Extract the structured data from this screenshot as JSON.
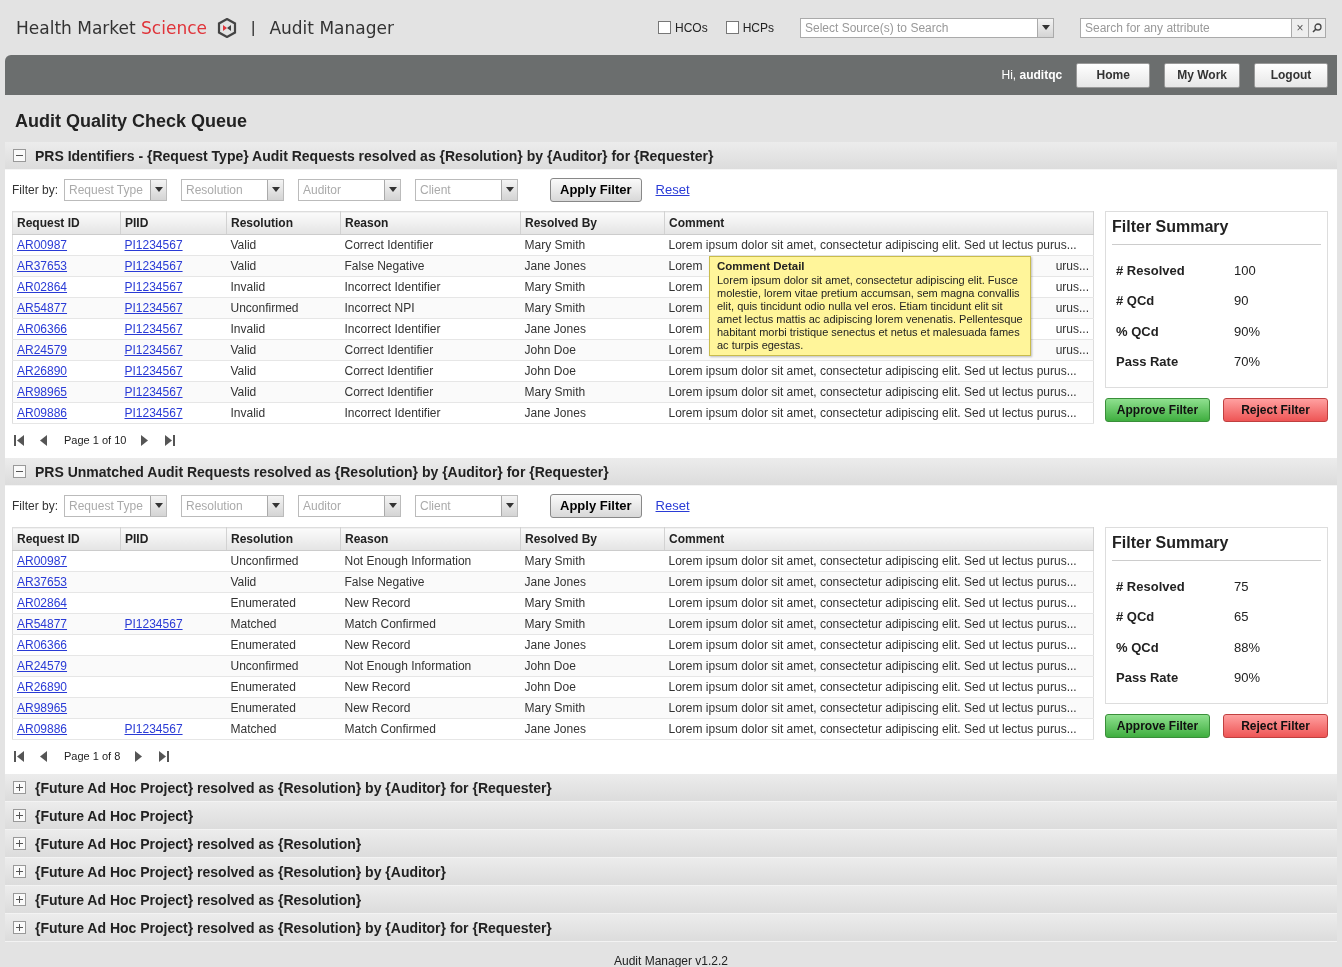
{
  "header": {
    "brand_part1": "Health Market ",
    "brand_part2": "Science",
    "separator": "|",
    "app_name": "Audit Manager",
    "checkboxes": [
      {
        "label": "HCOs",
        "checked": false
      },
      {
        "label": "HCPs",
        "checked": false
      }
    ],
    "source_select": {
      "placeholder": "Select Source(s) to Search"
    },
    "search": {
      "placeholder": "Search for any attribute",
      "clear": "×"
    }
  },
  "nav": {
    "greeting": "Hi, ",
    "user": "auditqc",
    "buttons": [
      "Home",
      "My Work",
      "Logout"
    ]
  },
  "page_title": "Audit Quality Check Queue",
  "sections": [
    {
      "title": "PRS Identifiers - {Request Type} Audit Requests resolved as {Resolution} by {Auditor} for {Requester}",
      "expanded": true,
      "filter_label": "Filter by:",
      "filters": [
        "Request Type",
        "Resolution",
        "Auditor",
        "Client"
      ],
      "apply": "Apply Filter",
      "reset": "Reset",
      "columns": [
        "Request ID",
        "PIID",
        "Resolution",
        "Reason",
        "Resolved By",
        "Comment"
      ],
      "rows": [
        {
          "id": "AR00987",
          "piid": "PI1234567",
          "resolution": "Valid",
          "reason": "Correct Identifier",
          "by": "Mary Smith",
          "comment": "Lorem ipsum dolor sit amet, consectetur adipiscing elit. Sed ut lectus purus..."
        },
        {
          "id": "AR37653",
          "piid": "PI1234567",
          "resolution": "Valid",
          "reason": "False Negative",
          "by": "Jane Jones",
          "comment": "Lorem",
          "comment_end": "urus..."
        },
        {
          "id": "AR02864",
          "piid": "PI1234567",
          "resolution": "Invalid",
          "reason": "Incorrect Identifier",
          "by": "Mary Smith",
          "comment": "Lorem",
          "comment_end": "urus..."
        },
        {
          "id": "AR54877",
          "piid": "PI1234567",
          "resolution": "Unconfirmed",
          "reason": "Incorrect NPI",
          "by": "Mary Smith",
          "comment": "Lorem",
          "comment_end": "urus..."
        },
        {
          "id": "AR06366",
          "piid": "PI1234567",
          "resolution": "Invalid",
          "reason": "Incorrect Identifier",
          "by": "Jane Jones",
          "comment": "Lorem",
          "comment_end": "urus..."
        },
        {
          "id": "AR24579",
          "piid": "PI1234567",
          "resolution": "Valid",
          "reason": "Correct Identifier",
          "by": "John Doe",
          "comment": "Lorem",
          "comment_end": "urus..."
        },
        {
          "id": "AR26890",
          "piid": "PI1234567",
          "resolution": "Valid",
          "reason": "Correct Identifier",
          "by": "John Doe",
          "comment": "Lorem ipsum dolor sit amet, consectetur adipiscing elit. Sed ut lectus purus..."
        },
        {
          "id": "AR98965",
          "piid": "PI1234567",
          "resolution": "Valid",
          "reason": "Correct Identifier",
          "by": "Mary Smith",
          "comment": "Lorem ipsum dolor sit amet, consectetur adipiscing elit. Sed ut lectus purus..."
        },
        {
          "id": "AR09886",
          "piid": "PI1234567",
          "resolution": "Invalid",
          "reason": "Incorrect Identifier",
          "by": "Jane Jones",
          "comment": "Lorem ipsum dolor sit amet, consectetur adipiscing elit. Sed ut lectus purus..."
        }
      ],
      "tooltip": {
        "title": "Comment Detail",
        "text": "Lorem ipsum dolor sit amet, consectetur adipiscing elit. Fusce molestie, lorem vitae pretium accumsan, sem magna convallis elit, quis tincidunt odio nulla vel eros. Etiam tincidunt elit sit amet lectus mattis ac adipiscing lorem venenatis. Pellentesque habitant morbi tristique senectus et netus et malesuada fames ac turpis egestas."
      },
      "pager": "Page 1 of 10",
      "summary": {
        "title": "Filter Summary",
        "stats": [
          {
            "label": "# Resolved",
            "value": "100"
          },
          {
            "label": "# QCd",
            "value": "90"
          },
          {
            "label": "% QCd",
            "value": "90%"
          },
          {
            "label": "Pass Rate",
            "value": "70%"
          }
        ],
        "approve": "Approve Filter",
        "reject": "Reject Filter"
      }
    },
    {
      "title": "PRS Unmatched Audit Requests resolved as {Resolution} by {Auditor} for {Requester}",
      "expanded": true,
      "filter_label": "Filter by:",
      "filters": [
        "Request Type",
        "Resolution",
        "Auditor",
        "Client"
      ],
      "apply": "Apply Filter",
      "reset": "Reset",
      "columns": [
        "Request ID",
        "PIID",
        "Resolution",
        "Reason",
        "Resolved By",
        "Comment"
      ],
      "rows": [
        {
          "id": "AR00987",
          "resolution": "Unconfirmed",
          "reason": "Not Enough Information",
          "by": "Mary Smith",
          "comment": "Lorem ipsum dolor sit amet, consectetur adipiscing elit. Sed ut lectus purus..."
        },
        {
          "id": "AR37653",
          "resolution": "Valid",
          "reason": "False Negative",
          "by": "Jane Jones",
          "comment": "Lorem ipsum dolor sit amet, consectetur adipiscing elit. Sed ut lectus purus..."
        },
        {
          "id": "AR02864",
          "resolution": "Enumerated",
          "reason": "New Record",
          "by": "Mary Smith",
          "comment": "Lorem ipsum dolor sit amet, consectetur adipiscing elit. Sed ut lectus purus..."
        },
        {
          "id": "AR54877",
          "piid": "PI1234567",
          "resolution": "Matched",
          "reason": "Match Confirmed",
          "by": "Mary Smith",
          "comment": "Lorem ipsum dolor sit amet, consectetur adipiscing elit. Sed ut lectus purus..."
        },
        {
          "id": "AR06366",
          "resolution": "Enumerated",
          "reason": "New Record",
          "by": "Jane Jones",
          "comment": "Lorem ipsum dolor sit amet, consectetur adipiscing elit. Sed ut lectus purus..."
        },
        {
          "id": "AR24579",
          "resolution": "Unconfirmed",
          "reason": "Not Enough Information",
          "by": "John Doe",
          "comment": "Lorem ipsum dolor sit amet, consectetur adipiscing elit. Sed ut lectus purus..."
        },
        {
          "id": "AR26890",
          "resolution": "Enumerated",
          "reason": "New Record",
          "by": "John Doe",
          "comment": "Lorem ipsum dolor sit amet, consectetur adipiscing elit. Sed ut lectus purus..."
        },
        {
          "id": "AR98965",
          "resolution": "Enumerated",
          "reason": "New Record",
          "by": "Mary Smith",
          "comment": "Lorem ipsum dolor sit amet, consectetur adipiscing elit. Sed ut lectus purus..."
        },
        {
          "id": "AR09886",
          "piid": "PI1234567",
          "resolution": "Matched",
          "reason": "Match Confirmed",
          "by": "Jane Jones",
          "comment": "Lorem ipsum dolor sit amet, consectetur adipiscing elit. Sed ut lectus purus..."
        }
      ],
      "pager": "Page 1 of 8",
      "summary": {
        "title": "Filter Summary",
        "stats": [
          {
            "label": "# Resolved",
            "value": "75"
          },
          {
            "label": "# QCd",
            "value": "65"
          },
          {
            "label": "% QCd",
            "value": "88%"
          },
          {
            "label": "Pass Rate",
            "value": "90%"
          }
        ],
        "approve": "Approve Filter",
        "reject": "Reject Filter"
      }
    },
    {
      "title": "{Future Ad Hoc Project} resolved as {Resolution} by {Auditor} for {Requester}",
      "expanded": false
    },
    {
      "title": "{Future Ad Hoc Project}",
      "expanded": false
    },
    {
      "title": "{Future Ad Hoc Project} resolved as {Resolution}",
      "expanded": false
    },
    {
      "title": "{Future Ad Hoc Project} resolved as {Resolution} by {Auditor}",
      "expanded": false
    },
    {
      "title": "{Future Ad Hoc Project} resolved as {Resolution}",
      "expanded": false
    },
    {
      "title": "{Future Ad Hoc Project} resolved as {Resolution} by {Auditor} for {Requester}",
      "expanded": false
    }
  ],
  "footer": "Audit Manager v1.2.2"
}
